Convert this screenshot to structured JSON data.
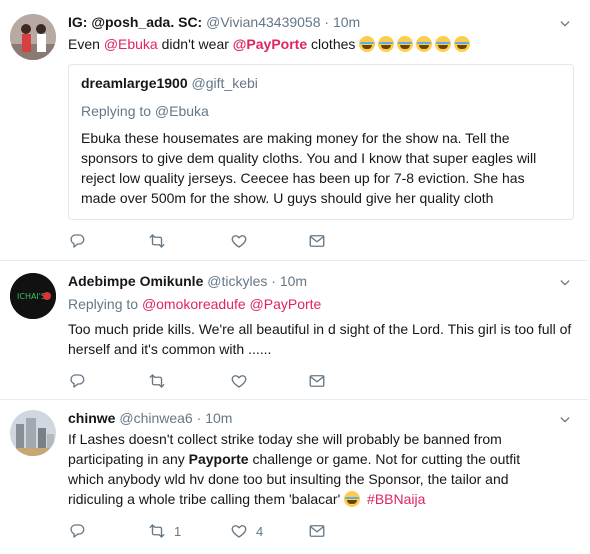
{
  "tweets": [
    {
      "name": "IG: @posh_ada. SC:",
      "handle": "@Vivian43439058",
      "sep": "·",
      "time": "10m",
      "text_pre": "Even ",
      "mention1": "@Ebuka",
      "text_mid": " didn't wear ",
      "mention2": "@PayPorte",
      "text_post": " clothes ",
      "emoji_count": 6,
      "quote": {
        "name": "dreamlarge1900",
        "handle": "@gift_kebi",
        "replying": "Replying to @Ebuka",
        "text": "Ebuka these housemates are making money for the show na. Tell the sponsors to give dem quality cloths. You and I know that super eagles will reject low quality jerseys. Ceecee has been up for 7-8 eviction. She has made over 500m for the show. U guys should give her quality cloth"
      }
    },
    {
      "name": "Adebimpe Omikunle",
      "handle": "@tickyles",
      "sep": "·",
      "time": "10m",
      "replying_label": "Replying to ",
      "reply_mention1": "@omokoreadufe",
      "reply_mention2": "@PayPorte",
      "text": "Too much pride  kills. We're all beautiful in d sight of the Lord. This  girl is too full of herself and it's common with ......"
    },
    {
      "name": "chinwe",
      "handle": "@chinwea6",
      "sep": "·",
      "time": "10m",
      "text_pre": "If Lashes doesn't collect strike today she will probably be banned from participating in any ",
      "bold": "Payporte",
      "text_mid": " challenge or game. Not for cutting the outfit which anybody wld hv done too but insulting the Sponsor, the tailor and ridiculing a whole tribe calling them 'balacar' ",
      "hashtag": "#BBNaija",
      "retweets": "1",
      "likes": "4"
    }
  ],
  "icons": [
    "reply-icon",
    "retweet-icon",
    "like-icon",
    "dm-icon",
    "caret-down-icon"
  ],
  "colors": {
    "link": "#e0245e",
    "muted": "#657786",
    "border": "#e6ecf0"
  }
}
